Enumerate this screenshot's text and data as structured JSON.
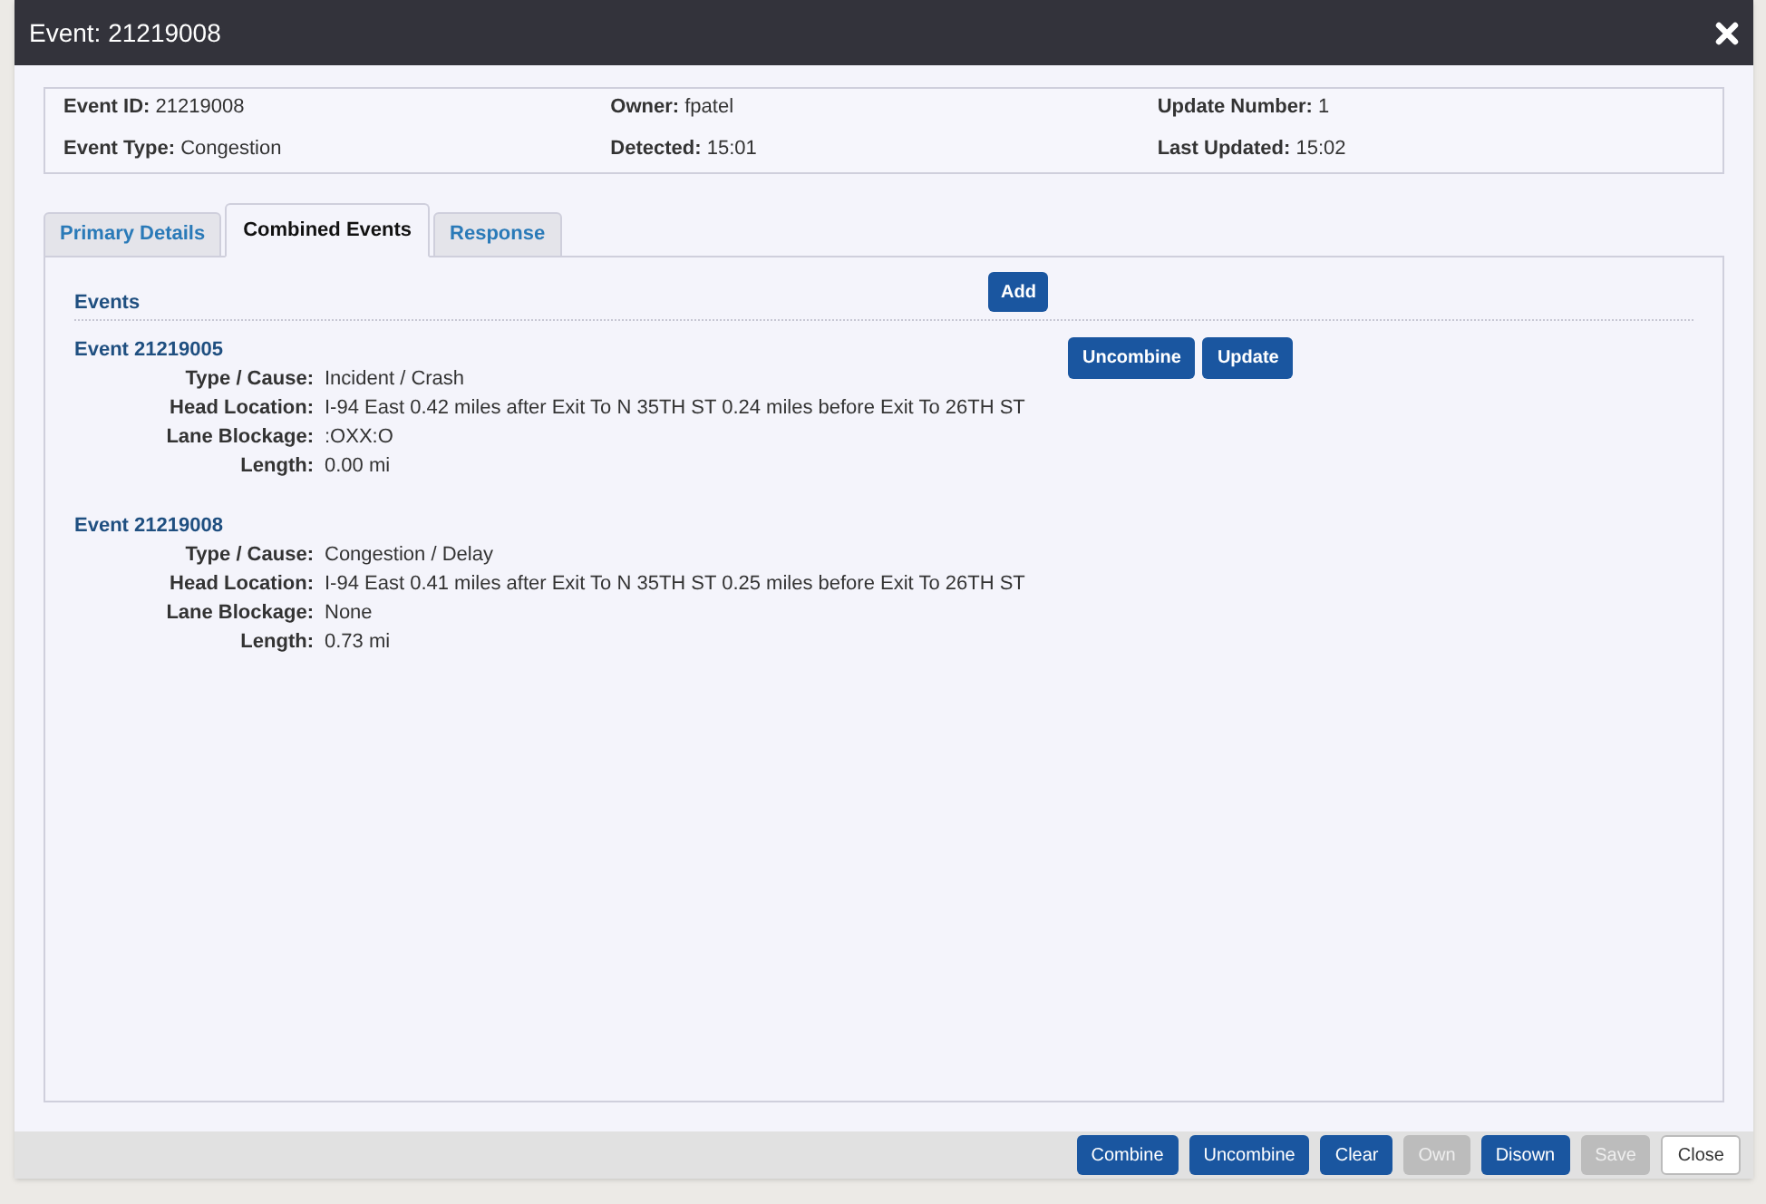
{
  "window": {
    "title": "Event: 21219008"
  },
  "summary": [
    {
      "label": "Event ID:",
      "value": "21219008"
    },
    {
      "label": "Owner:",
      "value": "fpatel"
    },
    {
      "label": "Update Number:",
      "value": "1"
    },
    {
      "label": "Event Type:",
      "value": "Congestion"
    },
    {
      "label": "Detected:",
      "value": "15:01"
    },
    {
      "label": "Last Updated:",
      "value": "15:02"
    }
  ],
  "tabs": [
    {
      "label": "Primary Details",
      "selected": false
    },
    {
      "label": "Combined Events",
      "selected": true
    },
    {
      "label": "Response",
      "selected": false
    }
  ],
  "events_panel": {
    "heading": "Events",
    "add_button": "Add",
    "events": [
      {
        "title": "Event 21219005",
        "buttons": [
          "Uncombine",
          "Update"
        ],
        "fields": [
          {
            "label": "Type / Cause:",
            "value": "Incident / Crash"
          },
          {
            "label": "Head Location:",
            "value": "I-94 East 0.42 miles after Exit To N 35TH ST 0.24 miles before Exit To 26TH ST"
          },
          {
            "label": "Lane Blockage:",
            "value": ":OXX:O"
          },
          {
            "label": "Length:",
            "value": "0.00 mi"
          }
        ]
      },
      {
        "title": "Event 21219008",
        "fields": [
          {
            "label": "Type / Cause:",
            "value": "Congestion / Delay"
          },
          {
            "label": "Head Location:",
            "value": "I-94 East 0.41 miles after Exit To N 35TH ST 0.25 miles before Exit To 26TH ST"
          },
          {
            "label": "Lane Blockage:",
            "value": "None"
          },
          {
            "label": "Length:",
            "value": "0.73 mi"
          }
        ]
      }
    ]
  },
  "footer_buttons": [
    {
      "label": "Combine",
      "kind": "primary",
      "disabled": false
    },
    {
      "label": "Uncombine",
      "kind": "primary",
      "disabled": false
    },
    {
      "label": "Clear",
      "kind": "primary",
      "disabled": false
    },
    {
      "label": "Own",
      "kind": "primary",
      "disabled": true
    },
    {
      "label": "Disown",
      "kind": "primary",
      "disabled": false
    },
    {
      "label": "Save",
      "kind": "primary",
      "disabled": true
    },
    {
      "label": "Close",
      "kind": "default",
      "disabled": false
    }
  ]
}
